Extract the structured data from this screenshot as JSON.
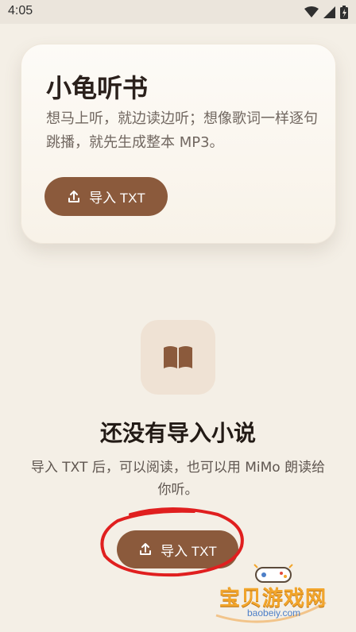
{
  "status_bar": {
    "time": "4:05"
  },
  "hero": {
    "title": "小龟听书",
    "description": "想马上听，就边读边听；想像歌词一样逐句跳播，就先生成整本 MP3。",
    "import_button_label": "导入 TXT"
  },
  "empty_state": {
    "title": "还没有导入小说",
    "description": "导入 TXT 后，可以阅读，也可以用 MiMo 朗读给你听。",
    "import_button_label": "导入 TXT"
  },
  "watermark": {
    "brand": "宝贝游戏网",
    "url": "baobeiy.com"
  },
  "colors": {
    "accent": "#8b5a3c",
    "background": "#f4efe6",
    "highlight_ring": "#e01f1f"
  },
  "icons": {
    "wifi": "wifi-icon",
    "signal": "signal-icon",
    "battery": "battery-icon",
    "upload": "upload-icon",
    "book": "book-icon"
  }
}
